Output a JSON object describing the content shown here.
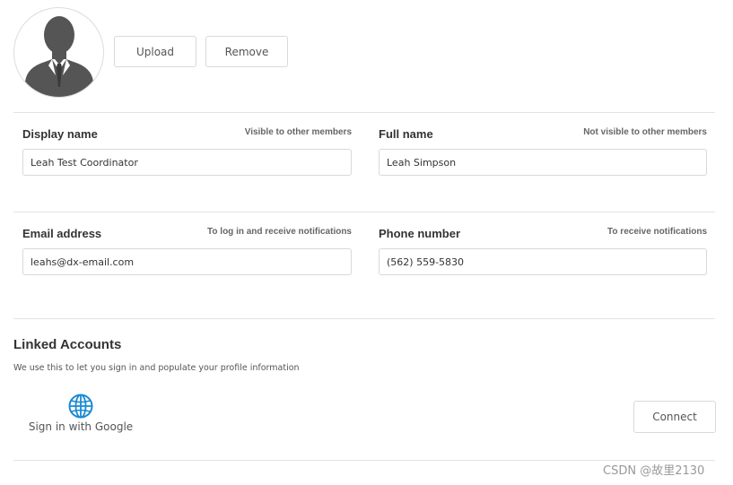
{
  "profile": {
    "avatar_icon": "user-silhouette-icon",
    "upload_label": "Upload",
    "remove_label": "Remove"
  },
  "fields": {
    "display_name": {
      "label": "Display name",
      "hint": "Visible to other members",
      "value": "Leah Test Coordinator"
    },
    "full_name": {
      "label": "Full name",
      "hint": "Not visible to other members",
      "value": "Leah Simpson"
    },
    "email": {
      "label": "Email address",
      "hint": "To log in and receive notifications",
      "value": "leahs@dx-email.com"
    },
    "phone": {
      "label": "Phone number",
      "hint": "To receive notifications",
      "value": "(562) 559-5830"
    }
  },
  "linked_accounts": {
    "title": "Linked Accounts",
    "description": "We use this to let you sign in and populate your profile information",
    "provider_icon": "globe-icon",
    "provider_label": "Sign in with Google",
    "connect_label": "Connect"
  },
  "watermark": "CSDN @故里2130",
  "colors": {
    "globe": "#1a8ad4",
    "avatar_silhouette": "#555555",
    "border": "#d9d9d9",
    "divider": "#e3e3e3"
  }
}
